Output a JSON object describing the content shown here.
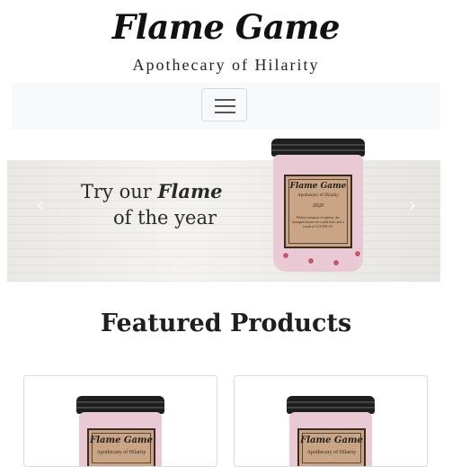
{
  "header": {
    "brand": "Flame Game",
    "tagline": "Apothecary of Hilarity"
  },
  "navbar": {
    "toggler_icon": "hamburger-icon"
  },
  "hero": {
    "line1_prefix": "Try our ",
    "line1_emphasis": "Flame",
    "line2": "of the year",
    "prev_icon": "chevron-left-icon",
    "next_icon": "chevron-right-icon",
    "jar": {
      "title": "Flame Game",
      "subtitle": "Apothecary of Hilarity",
      "year": "2020",
      "description": "Perfect infusion of pathos, the strangest house we could find, and a touch of COVID-19."
    }
  },
  "featured": {
    "title": "Featured Products",
    "products": [
      {
        "jar_title": "Flame Game",
        "jar_subtitle": "Apothecary of Hilarity"
      },
      {
        "jar_title": "Flame Game",
        "jar_subtitle": "Apothecary of Hilarity"
      }
    ]
  },
  "colors": {
    "jar_glass": "#e9c9d3",
    "jar_label": "#c9a585",
    "lid": "#1e1e1e",
    "navbar_bg": "#f8f9fa"
  }
}
